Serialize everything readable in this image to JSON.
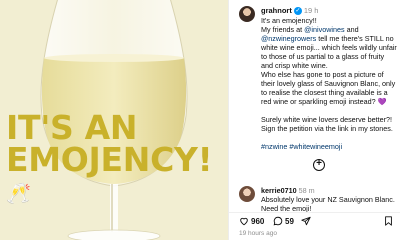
{
  "post": {
    "username": "grahnort",
    "verified": "✓",
    "age": "19 h",
    "caption": [
      "It's an emojency!!",
      "My friends at ",
      "@inivowines",
      " and",
      "@nzwinegrowers",
      " tell me there's STILL no white wine emoji... which feels wildly unfair to those of us partial to a glass of fruity and crisp white wine.",
      "Who else has gone to post a picture of their lovely glass of Sauvignon Blanc, only to realise the closest thing available is a red wine or sparkling emoji instead?",
      "💜",
      "Surely white wine lovers deserve better?! Sign the petition via the link in my stones.",
      "#nzwine #whitewineemoji"
    ]
  },
  "image": {
    "headline_line1": "IT'S AN",
    "headline_line2": "EMOJENCY!",
    "headline_emoji": "🥂",
    "colors": {
      "background": "#f2eed2",
      "headline": "#c9b12b",
      "wine": "#eee7b2"
    }
  },
  "comment": {
    "username": "kerrie0710",
    "age": "58 m",
    "text": "Absolutely love your NZ Sauvignon Blanc.",
    "text2": "Need the emoji!"
  },
  "actions": {
    "likes": "960",
    "comments": "59",
    "timestamp": "19 hours ago"
  },
  "icons": [
    "plus-circle-icon",
    "heart-icon",
    "comment-icon",
    "share-icon",
    "bookmark-icon",
    "verified-icon"
  ]
}
